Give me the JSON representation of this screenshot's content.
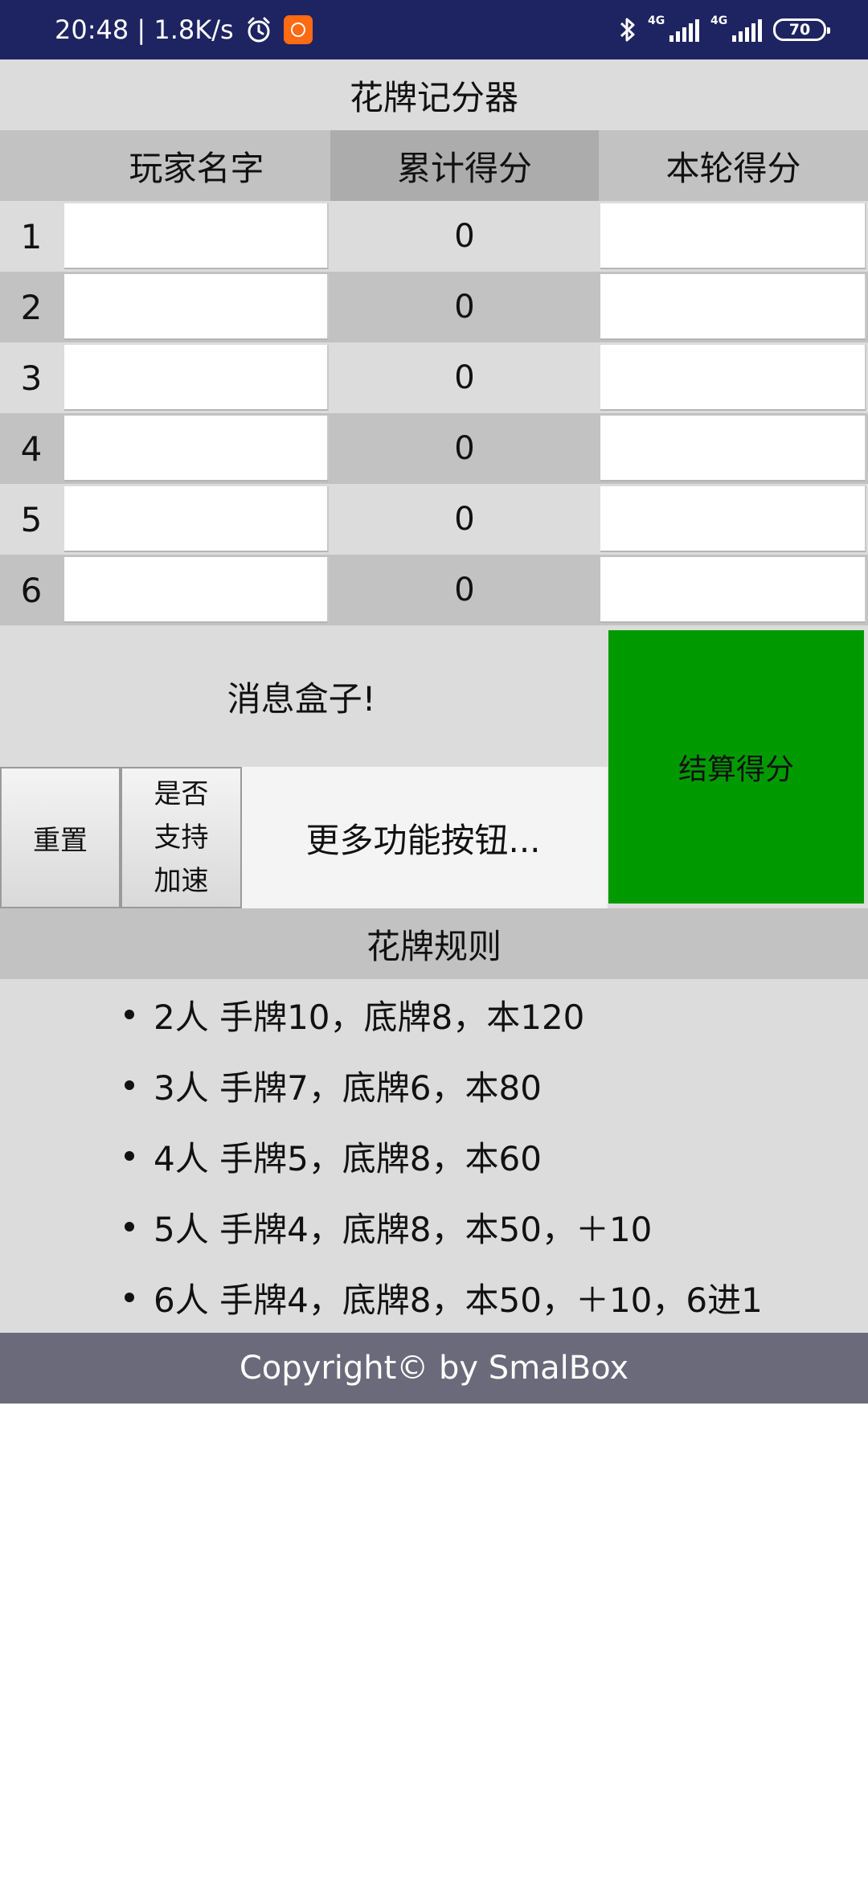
{
  "status_bar": {
    "time_speed": "20:48 | 1.8K/s",
    "network_1": "4G",
    "network_2": "4G",
    "battery": "70"
  },
  "app": {
    "title": "花牌记分器"
  },
  "table": {
    "headers": {
      "name": "玩家名字",
      "total": "累计得分",
      "round": "本轮得分"
    },
    "rows": [
      {
        "num": "1",
        "total": "0",
        "name_value": "",
        "round_value": ""
      },
      {
        "num": "2",
        "total": "0",
        "name_value": "",
        "round_value": ""
      },
      {
        "num": "3",
        "total": "0",
        "name_value": "",
        "round_value": ""
      },
      {
        "num": "4",
        "total": "0",
        "name_value": "",
        "round_value": ""
      },
      {
        "num": "5",
        "total": "0",
        "name_value": "",
        "round_value": ""
      },
      {
        "num": "6",
        "total": "0",
        "name_value": "",
        "round_value": ""
      }
    ]
  },
  "message_box": "消息盒子!",
  "buttons": {
    "settle": "结算得分",
    "reset": "重置",
    "speed_line1": "是否",
    "speed_line2": "支持",
    "speed_line3": "加速",
    "more": "更多功能按钮..."
  },
  "rules": {
    "title": "花牌规则",
    "items": [
      "2人 手牌10，底牌8，本120",
      "3人 手牌7，底牌6，本80",
      "4人 手牌5，底牌8，本60",
      "5人 手牌4，底牌8，本50，＋10",
      "6人 手牌4，底牌8，本50，＋10，6进1"
    ]
  },
  "footer": "Copyright© by SmalBox",
  "colors": {
    "status_bar": "#1e2461",
    "settle_button": "#009a00",
    "footer": "#6a6a7a",
    "row_light": "#dcdcdc",
    "row_dark": "#c2c2c2"
  }
}
